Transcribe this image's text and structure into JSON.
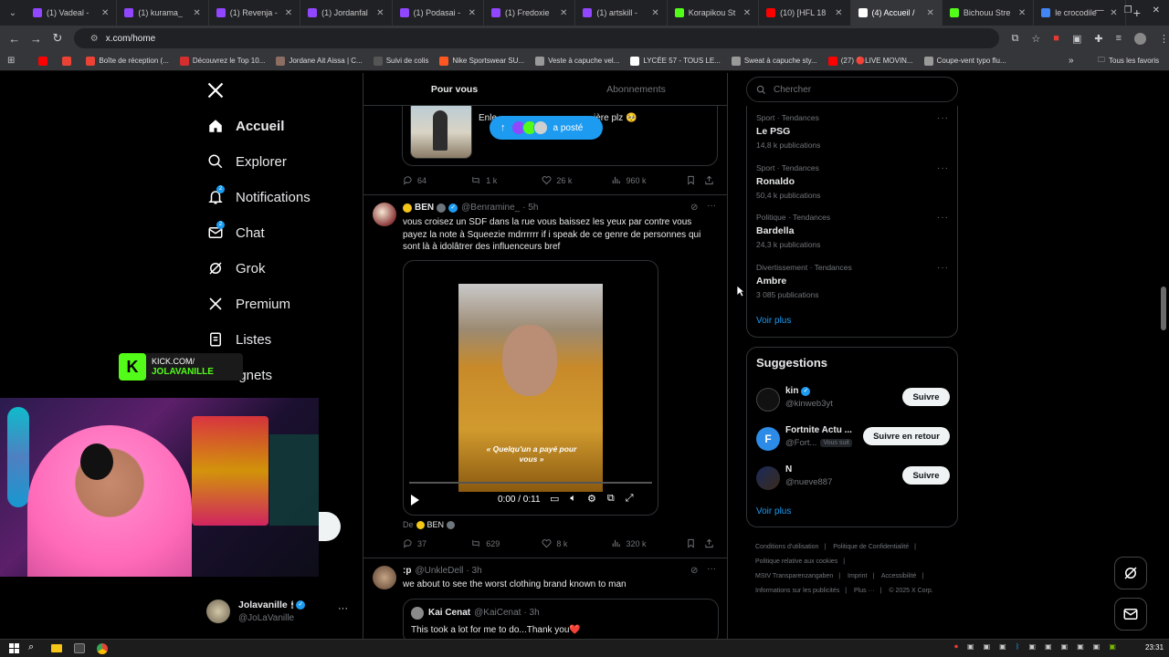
{
  "browser": {
    "tabs": [
      {
        "label": "(1) Vadeal -",
        "color": "#9146ff"
      },
      {
        "label": "(1) kurama_",
        "color": "#9146ff"
      },
      {
        "label": "(1) Revenja -",
        "color": "#9146ff"
      },
      {
        "label": "(1) Jordanfal",
        "color": "#9146ff"
      },
      {
        "label": "(1) Podasai -",
        "color": "#9146ff"
      },
      {
        "label": "(1) Fredoxie",
        "color": "#9146ff"
      },
      {
        "label": "(1) artskill -",
        "color": "#9146ff"
      },
      {
        "label": "Korapikou St",
        "color": "#53fc18"
      },
      {
        "label": "(10) [HFL 18",
        "color": "#ff0000"
      },
      {
        "label": "(4) Accueil /",
        "color": "#ffffff"
      },
      {
        "label": "Bichouu Stre",
        "color": "#53fc18"
      },
      {
        "label": "le crocodile",
        "color": "#4285f4"
      }
    ],
    "url": "x.com/home",
    "bookmarks": [
      {
        "label": "",
        "color": "#ff0000"
      },
      {
        "label": "",
        "color": "#ea4335"
      },
      {
        "label": "Boîte de réception (...",
        "color": "#ea4335"
      },
      {
        "label": "Découvrez le Top 10...",
        "color": "#d32f2f"
      },
      {
        "label": "Jordane Ait Aissa | C...",
        "color": "#8d6e63"
      },
      {
        "label": "Suivi de colis",
        "color": "#555555"
      },
      {
        "label": "Nike Sportswear SU...",
        "color": "#ff5722"
      },
      {
        "label": "Veste à capuche vel...",
        "color": "#999999"
      },
      {
        "label": "LYCÉE 57 - TOUS LE...",
        "color": "#ffffff"
      },
      {
        "label": "Sweat à capuche sty...",
        "color": "#999999"
      },
      {
        "label": "(27) 🔴LIVE MOVIN...",
        "color": "#ff0000"
      },
      {
        "label": "Coupe-vent typo flu...",
        "color": "#999999"
      }
    ],
    "all_bookmarks": "Tous les favoris"
  },
  "nav": {
    "items": [
      {
        "label": "Accueil",
        "icon": "home-icon"
      },
      {
        "label": "Explorer",
        "icon": "search-icon"
      },
      {
        "label": "Notifications",
        "icon": "bell-icon",
        "badge": "2"
      },
      {
        "label": "Chat",
        "icon": "mail-icon",
        "badge": "2"
      },
      {
        "label": "Grok",
        "icon": "grok-icon"
      },
      {
        "label": "Premium",
        "icon": "x-icon"
      },
      {
        "label": "Listes",
        "icon": "list-icon"
      },
      {
        "label": "Signets",
        "icon": "bookmark-icon"
      }
    ],
    "signets_visible": "ignets",
    "account_name": "Jolavanille",
    "account_handle": "@JoLaVanille"
  },
  "overlay": {
    "kick_line1": "KICK.COM/",
    "kick_line2": "JOLAVANILLE"
  },
  "feed": {
    "tabs": [
      "Pour vous",
      "Abonnements"
    ],
    "post0": {
      "text_start": "Enle",
      "text_end": "ière plz 🥺",
      "pill_label": "a posté",
      "replies": "64",
      "reposts": "1 k",
      "likes": "26 k",
      "views": "960 k"
    },
    "post1": {
      "name": "BEN",
      "handle": "@Benramine_",
      "time": "· 5h",
      "text": "vous croisez un SDF dans la rue vous baissez les yeux par contre vous payez la note à Squeezie mdrrrrrr if i speak de ce genre de personnes qui sont là à idolâtrer des influenceurs bref",
      "video_caption": "« Quelqu'un a payé pour vous »",
      "video_time": "0:00 / 0:11",
      "from_label": "De",
      "from_name": "BEN",
      "replies": "37",
      "reposts": "629",
      "likes": "8 k",
      "views": "320 k"
    },
    "post2": {
      "name": ":p",
      "handle": "@UnkleDell",
      "time": "· 3h",
      "text": "we about to see the worst clothing brand known to man",
      "quote_name": "Kai Cenat",
      "quote_handle": "@KaiCenat",
      "quote_time": "· 3h",
      "quote_text": "This took a lot for me to do...Thank you❤️"
    }
  },
  "right": {
    "search_placeholder": "Chercher",
    "trends": [
      {
        "category": "Sport · Tendances",
        "name": "Le PSG",
        "count": "14,8 k publications"
      },
      {
        "category": "Sport · Tendances",
        "name": "Ronaldo",
        "count": "50,4 k publications"
      },
      {
        "category": "Politique · Tendances",
        "name": "Bardella",
        "count": "24,3 k publications"
      },
      {
        "category": "Divertissement · Tendances",
        "name": "Ambre",
        "count": "3 085 publications"
      }
    ],
    "see_more": "Voir plus",
    "suggestions_title": "Suggestions",
    "suggestions": [
      {
        "name": "kin",
        "handle": "@kinweb3yt",
        "button": "Suivre"
      },
      {
        "name": "Fortnite Actu ...",
        "handle": "@Fort...",
        "follows_you": "Vous suit",
        "button": "Suivre en retour"
      },
      {
        "name": "N",
        "handle": "@nueve887",
        "button": "Suivre"
      }
    ],
    "see_more2": "Voir plus",
    "footer_links": [
      "Conditions d'utilisation",
      "Politique de Confidentialité",
      "Politique relative aux cookies",
      "MStV Transparenzangaben",
      "Imprint",
      "Accessibilité",
      "Informations sur les publicités",
      "Plus ···",
      "© 2025 X Corp."
    ]
  },
  "taskbar": {
    "time": "23:31"
  },
  "colors": {
    "accent": "#1d9bf0",
    "background": "#000000",
    "kick_green": "#53fc18"
  }
}
